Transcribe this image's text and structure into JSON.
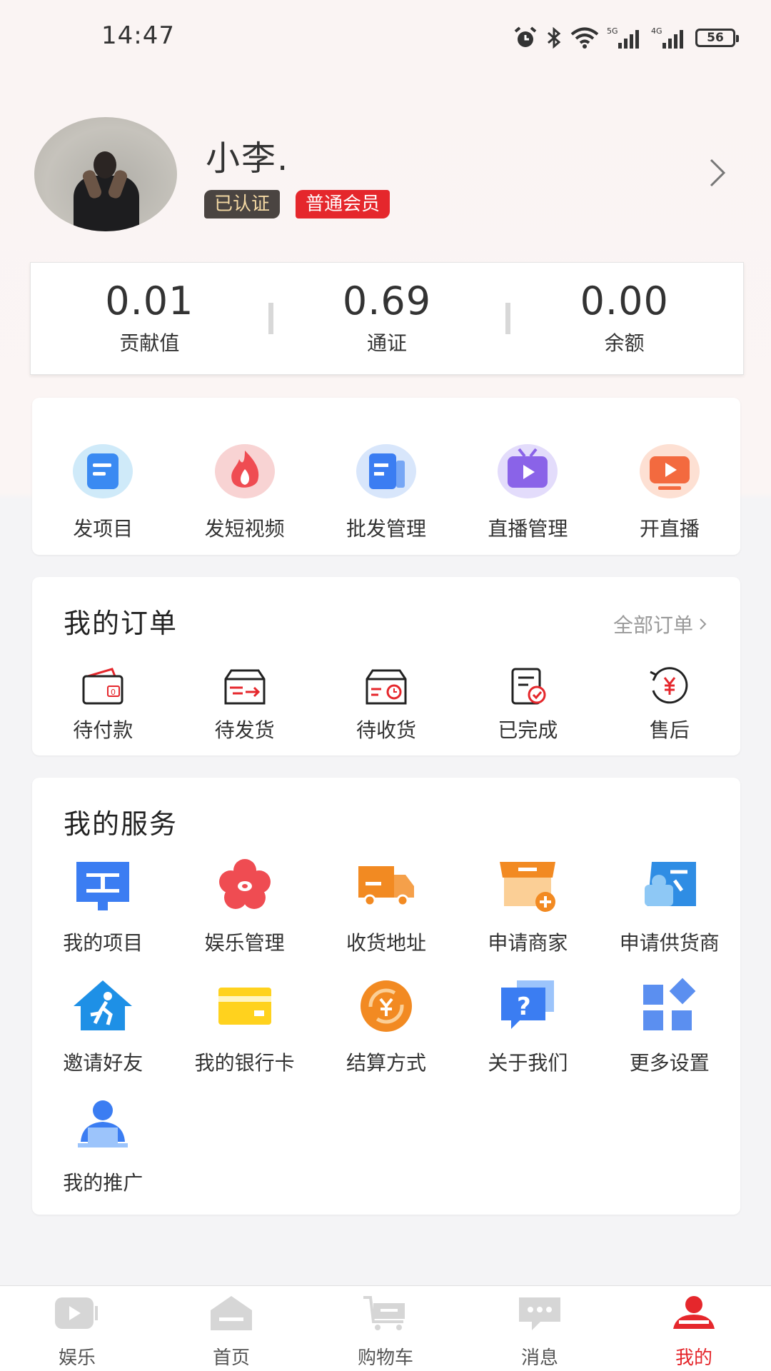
{
  "status_bar": {
    "time": "14:47",
    "battery": "56",
    "network_1": "5G",
    "network_2": "4G",
    "icons": [
      "alarm-icon",
      "bluetooth-icon",
      "wifi-icon",
      "signal-5g-icon",
      "signal-4g-icon",
      "battery-icon"
    ]
  },
  "profile": {
    "nickname": "小李.",
    "badges": [
      "已认证",
      "普通会员"
    ]
  },
  "stats": [
    {
      "value": "0.01",
      "label": "贡献值"
    },
    {
      "value": "0.69",
      "label": "通证"
    },
    {
      "value": "0.00",
      "label": "余额"
    }
  ],
  "quick_actions": [
    {
      "label": "发项目",
      "icon": "document-icon"
    },
    {
      "label": "发短视频",
      "icon": "flame-icon"
    },
    {
      "label": "批发管理",
      "icon": "wholesale-icon"
    },
    {
      "label": "直播管理",
      "icon": "tv-play-icon"
    },
    {
      "label": "开直播",
      "icon": "live-play-icon"
    }
  ],
  "orders": {
    "title": "我的订单",
    "all_label": "全部订单",
    "items": [
      {
        "label": "待付款",
        "icon": "wallet-icon"
      },
      {
        "label": "待发货",
        "icon": "ship-box-icon"
      },
      {
        "label": "待收货",
        "icon": "receive-box-icon"
      },
      {
        "label": "已完成",
        "icon": "completed-doc-icon"
      },
      {
        "label": "售后",
        "icon": "refund-yen-icon"
      }
    ]
  },
  "services": {
    "title": "我的服务",
    "items": [
      {
        "label": "我的项目",
        "icon": "project-board-icon"
      },
      {
        "label": "娱乐管理",
        "icon": "flower-icon"
      },
      {
        "label": "收货地址",
        "icon": "truck-icon"
      },
      {
        "label": "申请商家",
        "icon": "store-icon"
      },
      {
        "label": "申请供货商",
        "icon": "supplier-icon"
      },
      {
        "label": "邀请好友",
        "icon": "invite-house-icon"
      },
      {
        "label": "我的银行卡",
        "icon": "bank-card-icon"
      },
      {
        "label": "结算方式",
        "icon": "settlement-icon"
      },
      {
        "label": "关于我们",
        "icon": "question-icon"
      },
      {
        "label": "更多设置",
        "icon": "grid-settings-icon"
      },
      {
        "label": "我的推广",
        "icon": "promotion-user-icon"
      }
    ]
  },
  "tabbar": [
    {
      "label": "娱乐",
      "icon": "video-icon",
      "active": false
    },
    {
      "label": "首页",
      "icon": "home-icon",
      "active": false
    },
    {
      "label": "购物车",
      "icon": "cart-icon",
      "active": false
    },
    {
      "label": "消息",
      "icon": "message-icon",
      "active": false
    },
    {
      "label": "我的",
      "icon": "profile-icon",
      "active": true
    }
  ],
  "colors": {
    "accent": "#e5272c",
    "badge_dark": "#4a4441",
    "badge_gold_text": "#f3d8a3",
    "blue": "#3b7df2",
    "orange": "#f28a22",
    "text_muted": "#999999"
  }
}
